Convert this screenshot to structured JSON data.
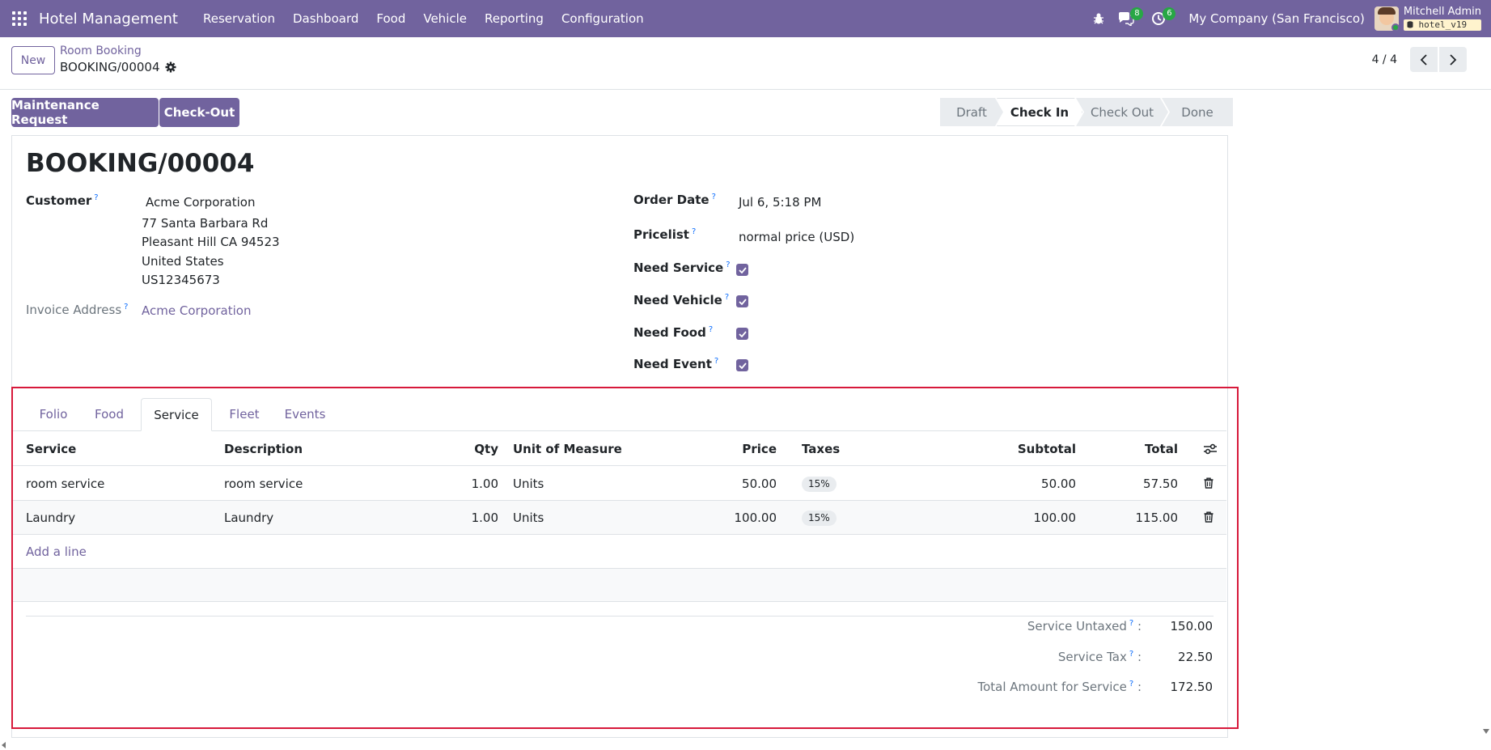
{
  "navbar": {
    "app_name": "Hotel Management",
    "menu": [
      "Reservation",
      "Dashboard",
      "Food",
      "Vehicle",
      "Reporting",
      "Configuration"
    ],
    "messages_count": "8",
    "activities_count": "6",
    "company": "My Company (San Francisco)",
    "user_name": "Mitchell Admin",
    "database": "hotel_v19",
    "color": "#71639e"
  },
  "control": {
    "new_label": "New",
    "breadcrumb": "Room Booking",
    "record": "BOOKING/00004",
    "pager": "4 / 4"
  },
  "actions": {
    "maintenance": "Maintenance Request",
    "checkout": "Check-Out"
  },
  "status": {
    "stages": [
      "Draft",
      "Check In",
      "Check Out",
      "Done"
    ],
    "active": "Check In"
  },
  "form": {
    "title": "BOOKING/00004",
    "customer_label": "Customer",
    "customer_name": "Acme Corporation",
    "address_line1": "77 Santa Barbara Rd",
    "address_line2": "Pleasant Hill CA 94523",
    "address_country": "United States",
    "address_vat": "US12345673",
    "invoice_label": "Invoice Address",
    "invoice_value": "Acme Corporation",
    "order_date_label": "Order Date",
    "order_date": "Jul 6, 5:18 PM",
    "pricelist_label": "Pricelist",
    "pricelist": "normal price (USD)",
    "need_service_label": "Need Service",
    "need_vehicle_label": "Need Vehicle",
    "need_food_label": "Need Food",
    "need_event_label": "Need Event",
    "need_service": true,
    "need_vehicle": true,
    "need_food": true,
    "need_event": true,
    "help_mark": "?"
  },
  "notebook": {
    "tabs": [
      "Folio",
      "Food",
      "Service",
      "Fleet",
      "Events"
    ],
    "active_tab": "Service",
    "columns": {
      "service": "Service",
      "description": "Description",
      "qty": "Qty",
      "uom": "Unit of Measure",
      "price": "Price",
      "taxes": "Taxes",
      "subtotal": "Subtotal",
      "total": "Total"
    },
    "rows": [
      {
        "service": "room service",
        "description": "room service",
        "qty": "1.00",
        "uom": "Units",
        "price": "50.00",
        "tax": "15%",
        "subtotal": "50.00",
        "total": "57.50"
      },
      {
        "service": "Laundry",
        "description": "Laundry",
        "qty": "1.00",
        "uom": "Units",
        "price": "100.00",
        "tax": "15%",
        "subtotal": "100.00",
        "total": "115.00"
      }
    ],
    "add_line": "Add a line",
    "totals": {
      "untaxed_label": "Service Untaxed",
      "untaxed": "150.00",
      "tax_label": "Service Tax",
      "tax": "22.50",
      "total_label": "Total Amount for Service",
      "total": "172.50",
      "colon": ":"
    }
  }
}
